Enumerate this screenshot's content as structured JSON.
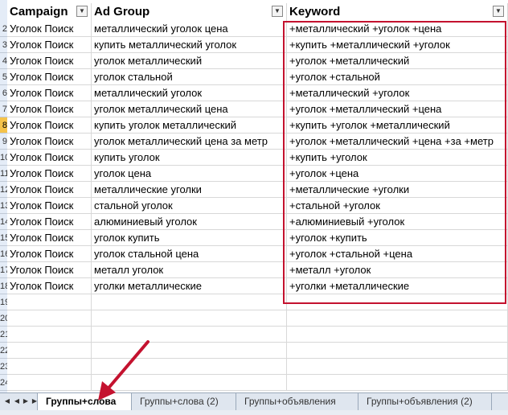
{
  "headers": {
    "campaign": "Campaign",
    "adgroup": "Ad Group",
    "keyword": "Keyword"
  },
  "row_numbers": [
    "2",
    "3",
    "4",
    "5",
    "6",
    "7",
    "8",
    "9",
    "10",
    "11",
    "12",
    "13",
    "14",
    "15",
    "16",
    "17",
    "18",
    "19",
    "20",
    "21",
    "22",
    "23",
    "24"
  ],
  "rows": [
    {
      "campaign": "Уголок Поиск",
      "adgroup": "металлический уголок цена",
      "keyword": "+металлический +уголок +цена"
    },
    {
      "campaign": "Уголок Поиск",
      "adgroup": "купить металлический уголок",
      "keyword": "+купить +металлический +уголок"
    },
    {
      "campaign": "Уголок Поиск",
      "adgroup": "уголок металлический",
      "keyword": "+уголок +металлический"
    },
    {
      "campaign": "Уголок Поиск",
      "adgroup": "уголок стальной",
      "keyword": "+уголок +стальной"
    },
    {
      "campaign": "Уголок Поиск",
      "adgroup": "металлический уголок",
      "keyword": "+металлический +уголок"
    },
    {
      "campaign": "Уголок Поиск",
      "adgroup": "уголок металлический цена",
      "keyword": "+уголок +металлический +цена"
    },
    {
      "campaign": "Уголок Поиск",
      "adgroup": "купить уголок металлический",
      "keyword": "+купить +уголок +металлический"
    },
    {
      "campaign": "Уголок Поиск",
      "adgroup": "уголок металлический цена за метр",
      "keyword": "+уголок +металлический +цена +за +метр"
    },
    {
      "campaign": "Уголок Поиск",
      "adgroup": "купить уголок",
      "keyword": "+купить +уголок"
    },
    {
      "campaign": "Уголок Поиск",
      "adgroup": "уголок цена",
      "keyword": "+уголок +цена"
    },
    {
      "campaign": "Уголок Поиск",
      "adgroup": "металлические уголки",
      "keyword": "+металлические +уголки"
    },
    {
      "campaign": "Уголок Поиск",
      "adgroup": "стальной уголок",
      "keyword": "+стальной +уголок"
    },
    {
      "campaign": "Уголок Поиск",
      "adgroup": "алюминиевый уголок",
      "keyword": "+алюминиевый +уголок"
    },
    {
      "campaign": "Уголок Поиск",
      "adgroup": "уголок купить",
      "keyword": "+уголок +купить"
    },
    {
      "campaign": "Уголок Поиск",
      "adgroup": "уголок стальной цена",
      "keyword": "+уголок +стальной +цена"
    },
    {
      "campaign": "Уголок Поиск",
      "adgroup": "металл уголок",
      "keyword": "+металл +уголок"
    },
    {
      "campaign": "Уголок Поиск",
      "adgroup": "уголки металлические",
      "keyword": "+уголки +металлические"
    }
  ],
  "tabs": [
    "Группы+слова",
    "Группы+слова (2)",
    "Группы+объявления",
    "Группы+объявления (2)"
  ],
  "colors": {
    "highlight_box": "#c4122f",
    "arrow": "#c4122f",
    "row_header_bg": "#e4ecf7",
    "selected_row_header": "#f5c34a"
  }
}
